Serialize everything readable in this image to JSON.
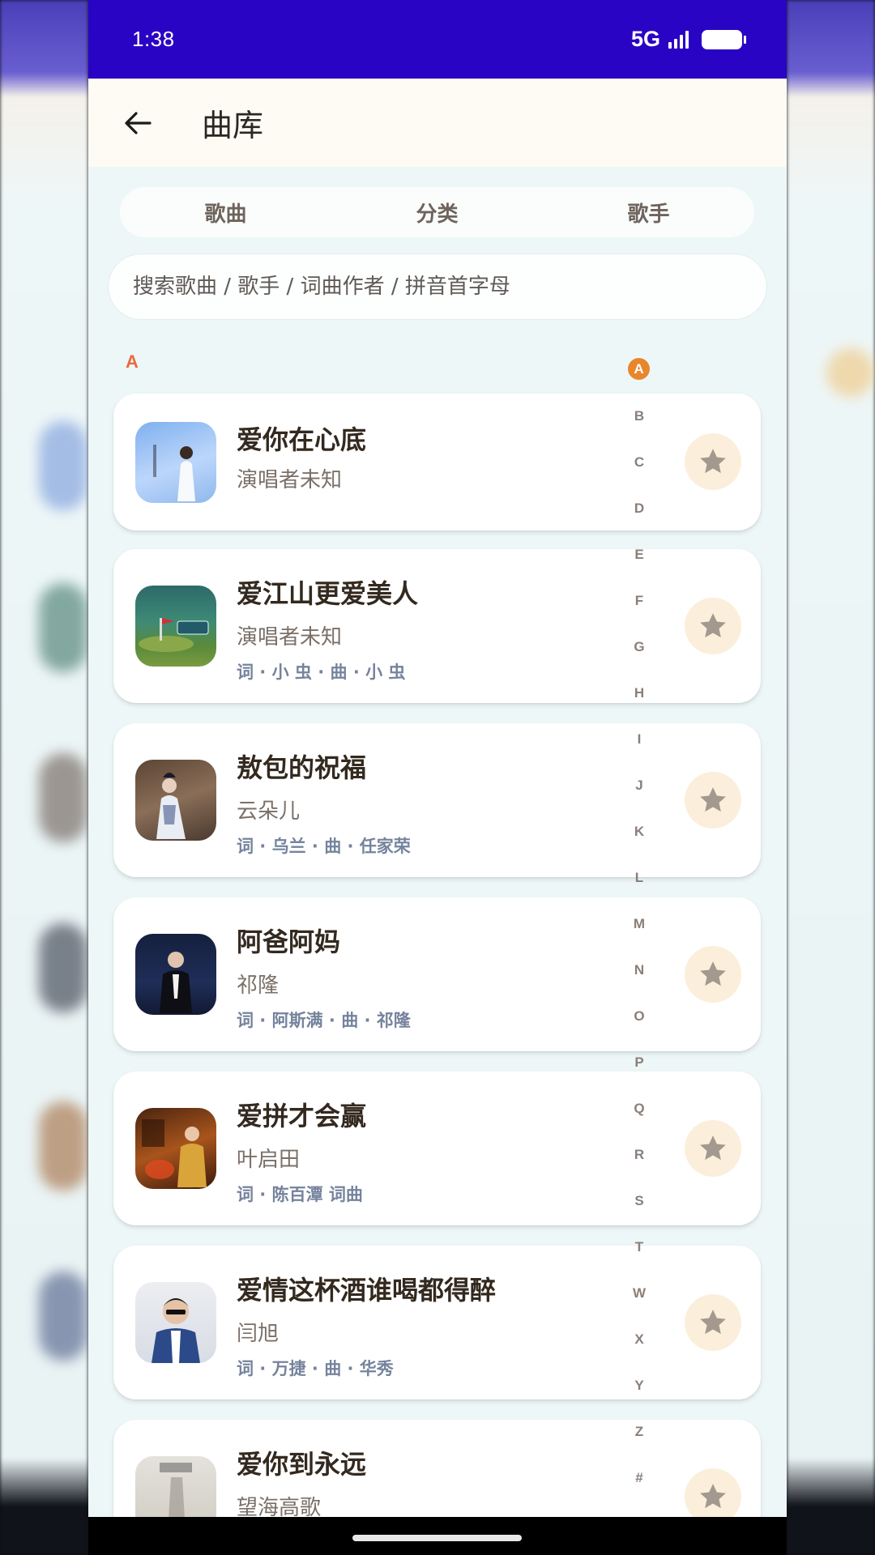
{
  "status_bar": {
    "time": "1:38",
    "network": "5G"
  },
  "app_bar": {
    "title": "曲库",
    "back_icon": "arrow-left-icon"
  },
  "tabs": [
    {
      "label": "歌曲"
    },
    {
      "label": "分类"
    },
    {
      "label": "歌手"
    }
  ],
  "search": {
    "placeholder": "搜索歌曲 / 歌手 / 词曲作者 / 拼音首字母",
    "value": ""
  },
  "section": {
    "letter": "A"
  },
  "songs": [
    {
      "title": "爱你在心底",
      "singer": "演唱者未知",
      "credits": ""
    },
    {
      "title": "爱江山更爱美人",
      "singer": "演唱者未知",
      "credits": "词 · 小 虫 · 曲 · 小 虫"
    },
    {
      "title": "敖包的祝福",
      "singer": "云朵儿",
      "credits": "词 · 乌兰 · 曲 · 任家荣"
    },
    {
      "title": "阿爸阿妈",
      "singer": "祁隆",
      "credits": "词 · 阿斯满 · 曲 · 祁隆"
    },
    {
      "title": "爱拼才会赢",
      "singer": "叶启田",
      "credits": "词 · 陈百潭 词曲"
    },
    {
      "title": "爱情这杯酒谁喝都得醉",
      "singer": "闫旭",
      "credits": "词 · 万捷 · 曲 · 华秀"
    },
    {
      "title": "爱你到永远",
      "singer": "望海高歌",
      "credits": ""
    }
  ],
  "alphabet": [
    "A",
    "B",
    "C",
    "D",
    "E",
    "F",
    "G",
    "H",
    "I",
    "J",
    "K",
    "L",
    "M",
    "N",
    "O",
    "P",
    "Q",
    "R",
    "S",
    "T",
    "W",
    "X",
    "Y",
    "Z",
    "#"
  ],
  "alphabet_active": "A",
  "icons": {
    "favorite": "star-icon",
    "signal": "signal-icon",
    "battery": "battery-icon"
  },
  "colors": {
    "status_bar": "#2a04c4",
    "accent": "#e8862b",
    "section_letter": "#ea6a3e",
    "fav_bg": "#fbefdc",
    "credits": "#75839c"
  }
}
